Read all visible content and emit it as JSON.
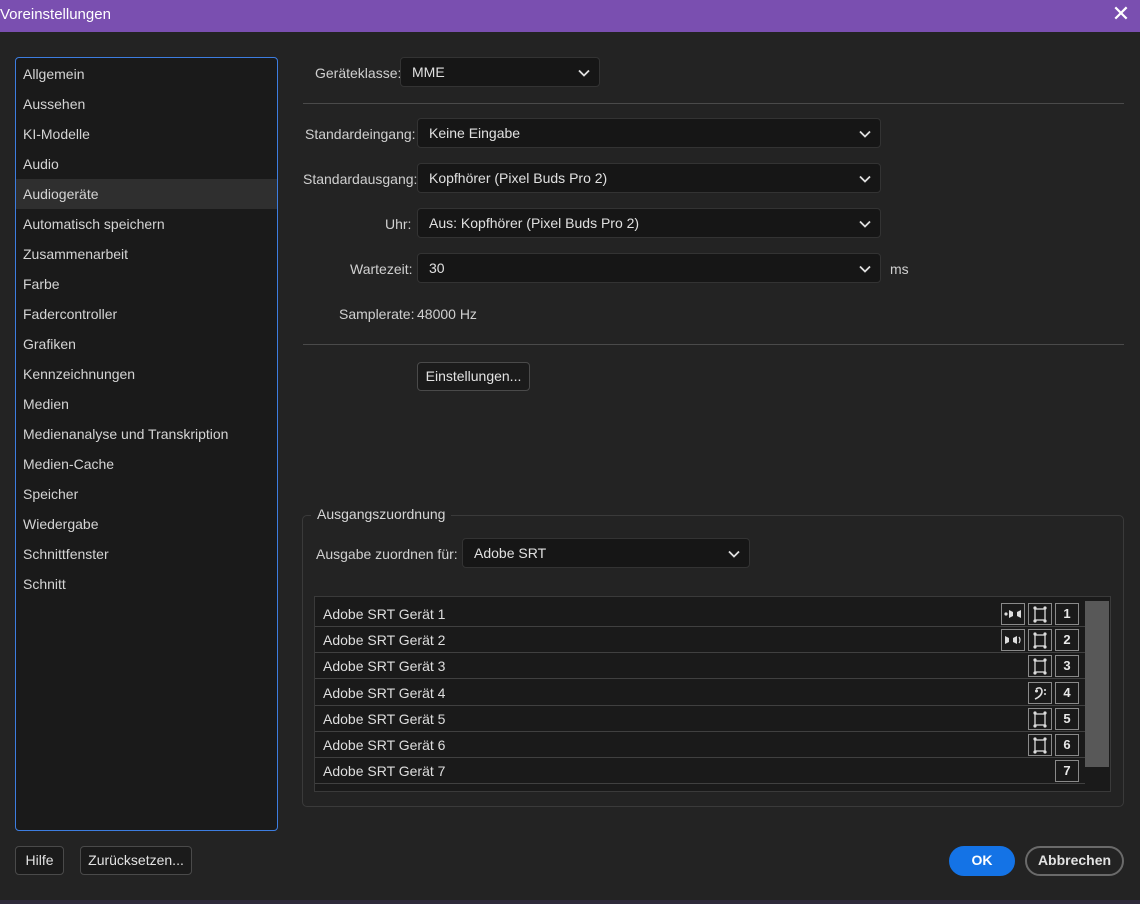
{
  "window": {
    "title": "Voreinstellungen"
  },
  "sidebar": {
    "items": [
      {
        "label": "Allgemein"
      },
      {
        "label": "Aussehen"
      },
      {
        "label": "KI-Modelle"
      },
      {
        "label": "Audio"
      },
      {
        "label": "Audiogeräte",
        "active": true
      },
      {
        "label": "Automatisch speichern"
      },
      {
        "label": "Zusammenarbeit"
      },
      {
        "label": "Farbe"
      },
      {
        "label": "Fadercontroller"
      },
      {
        "label": "Grafiken"
      },
      {
        "label": "Kennzeichnungen"
      },
      {
        "label": "Medien"
      },
      {
        "label": "Medienanalyse und Transkription"
      },
      {
        "label": "Medien-Cache"
      },
      {
        "label": "Speicher"
      },
      {
        "label": "Wiedergabe"
      },
      {
        "label": "Schnittfenster"
      },
      {
        "label": "Schnitt"
      }
    ]
  },
  "device": {
    "class_label": "Geräteklasse:",
    "class_value": "MME",
    "input_label": "Standardeingang:",
    "input_value": "Keine Eingabe",
    "output_label": "Standardausgang:",
    "output_value": "Kopfhörer (Pixel Buds Pro 2)",
    "clock_label": "Uhr:",
    "clock_value": "Aus: Kopfhörer (Pixel Buds Pro 2)",
    "latency_label": "Wartezeit:",
    "latency_value": "30",
    "latency_unit": "ms",
    "samplerate_label": "Samplerate:",
    "samplerate_value": "48000 Hz",
    "settings_button": "Einstellungen..."
  },
  "mapping": {
    "legend": "Ausgangszuordnung",
    "map_for_label": "Ausgabe zuordnen für:",
    "map_for_value": "Adobe SRT",
    "rows": [
      {
        "name": "Adobe SRT Gerät 1",
        "num": "1",
        "icons": [
          "speaker-left-icon",
          "mono-clip-icon"
        ]
      },
      {
        "name": "Adobe SRT Gerät 2",
        "num": "2",
        "icons": [
          "speaker-right-icon",
          "mono-clip-icon"
        ]
      },
      {
        "name": "Adobe SRT Gerät 3",
        "num": "3",
        "icons": [
          "mono-clip-icon"
        ]
      },
      {
        "name": "Adobe SRT Gerät 4",
        "num": "4",
        "icons": [
          "bass-clef-icon"
        ]
      },
      {
        "name": "Adobe SRT Gerät 5",
        "num": "5",
        "icons": [
          "mono-clip-icon"
        ]
      },
      {
        "name": "Adobe SRT Gerät 6",
        "num": "6",
        "icons": [
          "mono-clip-icon"
        ]
      },
      {
        "name": "Adobe SRT Gerät 7",
        "num": "7",
        "icons": []
      }
    ]
  },
  "footer": {
    "help_button": "Hilfe",
    "reset_button": "Zurücksetzen...",
    "ok_button": "OK",
    "cancel_button": "Abbrechen"
  },
  "colors": {
    "titlebar": "#7a4fb0",
    "accent": "#1473e6",
    "sidebar_border": "#3d7de0",
    "background": "#232323"
  }
}
